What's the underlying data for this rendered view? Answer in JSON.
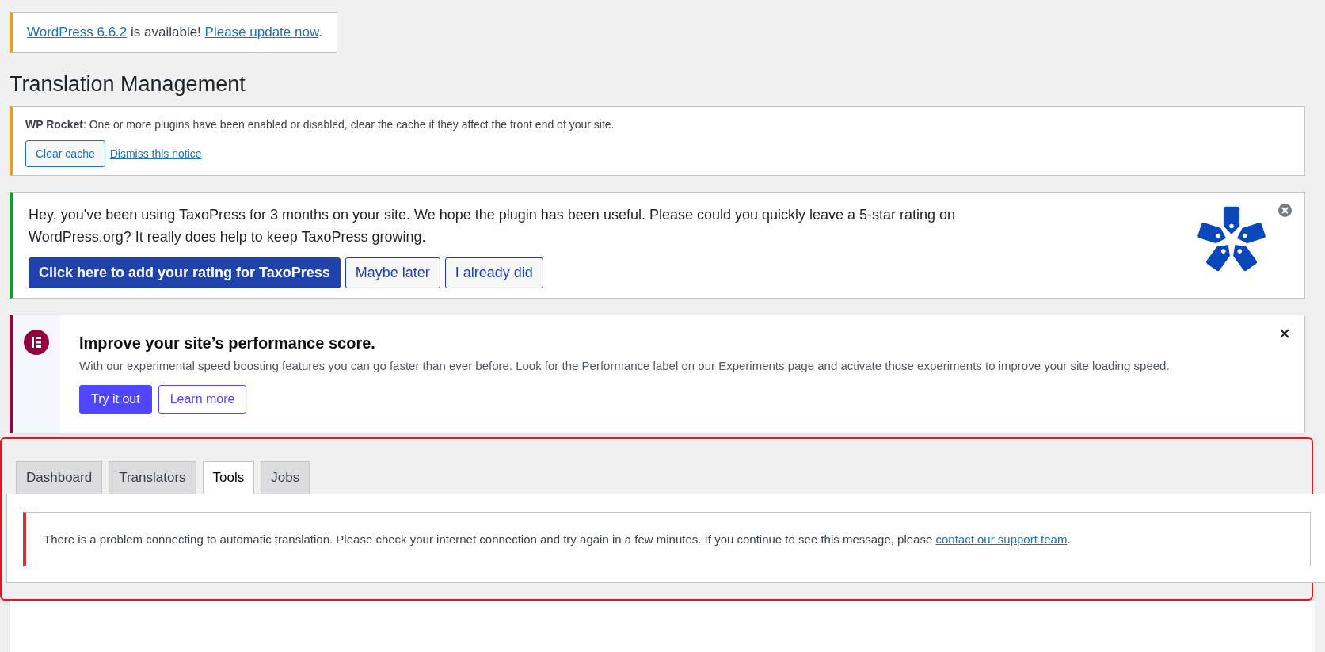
{
  "update_notice": {
    "parts": [
      {
        "kind": "link",
        "text": "WordPress 6.6.2"
      },
      {
        "kind": "text",
        "text": " is available! "
      },
      {
        "kind": "link",
        "text": "Please update now"
      },
      {
        "kind": "text",
        "text": "."
      }
    ]
  },
  "page_title": "Translation Management",
  "rocket_notice": {
    "message": "**WP Rocket**: One or more plugins have been enabled or disabled, clear the cache if they affect the front end of your site.",
    "button": "Clear cache",
    "dismiss_link": "Dismiss this notice"
  },
  "taxopress_notice": {
    "message": "Hey, you've been using TaxoPress for 3 months on your site. We hope the plugin has been useful. Please could you quickly leave a 5-star rating on WordPress.org? It really does help to keep TaxoPress growing.",
    "buttons": [
      {
        "kind": "primary",
        "label": "Click here to add your rating for TaxoPress"
      },
      {
        "kind": "secondary",
        "label": "Maybe later"
      },
      {
        "kind": "secondary",
        "label": "I already did"
      }
    ]
  },
  "elementor_notice": {
    "title": "Improve your site’s performance score.",
    "description": "With our experimental speed boosting features you can go faster than ever before. Look for the Performance label on our Experiments page and activate those experiments to improve your site loading speed.",
    "buttons": [
      {
        "kind": "primary",
        "label": "Try it out"
      },
      {
        "kind": "secondary",
        "label": "Learn more"
      }
    ]
  },
  "tabs": [
    {
      "label": "Dashboard",
      "selected": false
    },
    {
      "label": "Translators",
      "selected": false
    },
    {
      "label": "Tools",
      "selected": true
    },
    {
      "label": "Jobs",
      "selected": false
    }
  ],
  "error_notice": {
    "message": "There is a problem connecting to automatic translation. Please check your internet connection and try again in a few minutes. If you continue to see this message, please ",
    "link": "contact our support team",
    "suffix": "."
  }
}
